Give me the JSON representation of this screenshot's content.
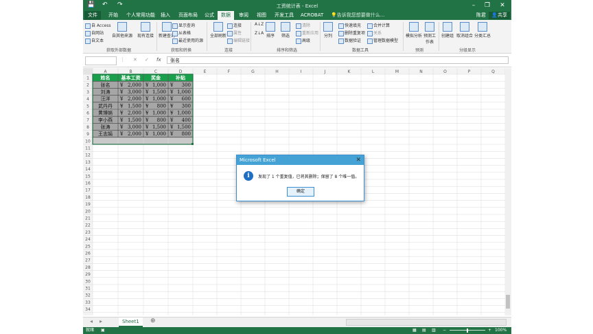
{
  "window": {
    "title": "工资统计表 - Excel",
    "user": "陈君"
  },
  "qat": {
    "save": "💾",
    "undo": "↶",
    "redo": "↷"
  },
  "ribbon_tabs": [
    "文件",
    "开始",
    "个人常用功能",
    "插入",
    "页面布局",
    "公式",
    "数据",
    "审阅",
    "视图",
    "开发工具",
    "ACROBAT"
  ],
  "active_tab": "数据",
  "tell_me": "告诉我您想要做什么...",
  "share": "共享",
  "ribbon": {
    "get_external": {
      "access": "自 Access",
      "web": "自网站",
      "text": "自文本",
      "other": "自其他来源",
      "existing": "现有连接",
      "label": "获取外部数据"
    },
    "transform": {
      "new_query": "新建查询",
      "show_queries": "显示查询",
      "from_table": "从表格",
      "recent": "最近使用的源",
      "label": "获取和转换"
    },
    "connections": {
      "refresh": "全部刷新",
      "conn": "连接",
      "props": "属性",
      "edit_links": "编辑链接",
      "label": "连接"
    },
    "sort_filter": {
      "sort": "排序",
      "filter": "筛选",
      "clear": "清除",
      "reapply": "重新应用",
      "advanced": "高级",
      "label": "排序和筛选"
    },
    "data_tools": {
      "split": "分列",
      "flash_fill": "快速填充",
      "remove_dup": "删除重复项",
      "validation": "数据验证",
      "consolidate": "合并计算",
      "relations": "关系",
      "model": "管理数据模型",
      "label": "数据工具"
    },
    "forecast": {
      "whatif": "模拟分析",
      "sheet": "预测工作表",
      "label": "预测"
    },
    "outline": {
      "group": "创建组",
      "ungroup": "取消组合",
      "subtotal": "分类汇总",
      "label": "分级显示"
    }
  },
  "formula_bar": {
    "name_box": "",
    "content": "张名"
  },
  "columns": [
    "A",
    "B",
    "C",
    "D",
    "E",
    "F",
    "G",
    "H",
    "I",
    "J",
    "K",
    "L",
    "M",
    "N",
    "O",
    "P",
    "Q"
  ],
  "row_count": 34,
  "table": {
    "headers": [
      "姓名",
      "基本工资",
      "奖金",
      "补贴"
    ],
    "rows": [
      [
        "张名",
        "¥ 2,000",
        "¥ 1,000",
        "¥ 300"
      ],
      [
        "刘涛",
        "¥ 3,000",
        "¥ 1,500",
        "¥ 1,000"
      ],
      [
        "汪洋",
        "¥ 2,000",
        "¥ 1,000",
        "¥ 600"
      ],
      [
        "武丹丹",
        "¥ 1,500",
        "¥ 800",
        "¥ 300"
      ],
      [
        "黄博娟",
        "¥ 2,000",
        "¥ 1,000",
        "¥ 1,000"
      ],
      [
        "李小燕",
        "¥ 1,500",
        "¥ 800",
        "¥ 400"
      ],
      [
        "张涛",
        "¥ 3,000",
        "¥ 1,500",
        "¥ 1,500"
      ],
      [
        "王志娟",
        "¥ 2,000",
        "¥ 1,000",
        "¥ 800"
      ]
    ]
  },
  "sheet": {
    "tab": "Sheet1",
    "add": "⊕"
  },
  "status": {
    "ready": "就绪",
    "zoom": "100%"
  },
  "dialog": {
    "title": "Microsoft Excel",
    "message": "发现了 1 个重复值，已将其删除；保留了 8 个唯一值。",
    "ok": "确定",
    "close": "✕",
    "icon": "i"
  },
  "colors": {
    "excel_green": "#217346",
    "header_green": "#1a9f4c",
    "table_gray": "#a6a6a6",
    "dialog_title": "#44a3d4"
  }
}
